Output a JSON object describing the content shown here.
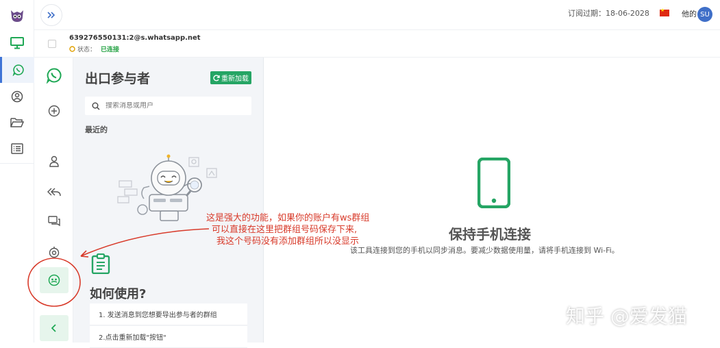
{
  "topbar": {
    "subscription_label": "订阅过期：18-06-2028",
    "user_label": "他的",
    "avatar_initials": "SU"
  },
  "account": {
    "id": "639276550131:2@s.whatsapp.net",
    "status_label": "状态：",
    "status_value": "已连接"
  },
  "panel": {
    "title": "出口参与者",
    "reload_label": "重新加载",
    "search_placeholder": "搜索消息或用户",
    "recent_label": "最近的",
    "howto_title": "如何使用?",
    "steps": [
      "1. 发送消息到您想要导出参与者的群组",
      "2.点击重新加载\"按钮\""
    ]
  },
  "main": {
    "title": "保持手机连接",
    "description": "该工具连接到您的手机以同步消息。要减少数据使用量，请将手机连接到 Wi-Fi。"
  },
  "annotation": {
    "lines": [
      "这是强大的功能，如果你的账户有ws群组",
      "可以直接在这里把群组号码保存下来,",
      "我这个号码没有添加群组所以没显示"
    ]
  },
  "watermark": "知乎 @爱发猫",
  "colors": {
    "accent_green": "#25a564",
    "whatsapp_green": "#1fa855",
    "annotation_red": "#d83a2a",
    "active_blue": "#3f74d6"
  }
}
